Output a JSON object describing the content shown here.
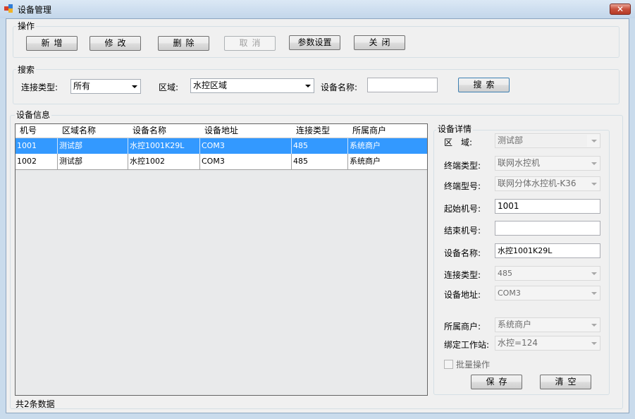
{
  "window": {
    "title": "设备管理",
    "close_glyph": "✕"
  },
  "operations": {
    "group_label": "操作",
    "buttons": {
      "add": "新增",
      "edit": "修改",
      "delete": "删除",
      "cancel": "取消",
      "params": "参数设置",
      "close": "关闭"
    }
  },
  "search": {
    "group_label": "搜索",
    "connection_type_label": "连接类型:",
    "connection_type_value": "所有",
    "area_label": "区域:",
    "area_value": "水控区域",
    "device_name_label": "设备名称:",
    "device_name_value": "",
    "search_button": "搜索"
  },
  "device_info": {
    "group_label": "设备信息",
    "columns": [
      "机号",
      "区域名称",
      "设备名称",
      "设备地址",
      "连接类型",
      "所属商户"
    ],
    "rows": [
      [
        "1001",
        "测试部",
        "水控1001K29L",
        "COM3",
        "485",
        "系统商户"
      ],
      [
        "1002",
        "测试部",
        "水控1002",
        "COM3",
        "485",
        "系统商户"
      ]
    ],
    "selected_row": 0,
    "footer": "共2条数据"
  },
  "details": {
    "group_label": "设备详情",
    "area_label": "区　域:",
    "area_value": "测试部",
    "terminal_type_label": "终端类型:",
    "terminal_type_value": "联网水控机",
    "terminal_model_label": "终端型号:",
    "terminal_model_value": "联网分体水控机-K36",
    "start_no_label": "起始机号:",
    "start_no_value": "1001",
    "end_no_label": "结束机号:",
    "end_no_value": "",
    "device_name_label": "设备名称:",
    "device_name_value": "水控1001K29L",
    "connection_type_label": "连接类型:",
    "connection_type_value": "485",
    "device_address_label": "设备地址:",
    "device_address_value": "COM3",
    "merchant_label": "所属商户:",
    "merchant_value": "系统商户",
    "workstation_label": "绑定工作站:",
    "workstation_value": "水控=124",
    "batch_label": "批量操作",
    "batch_checked": false,
    "save_button": "保存",
    "clear_button": "清空"
  },
  "colors": {
    "selection": "#3399ff",
    "frame": "#c9dbec",
    "close_button": "#c8503c"
  }
}
